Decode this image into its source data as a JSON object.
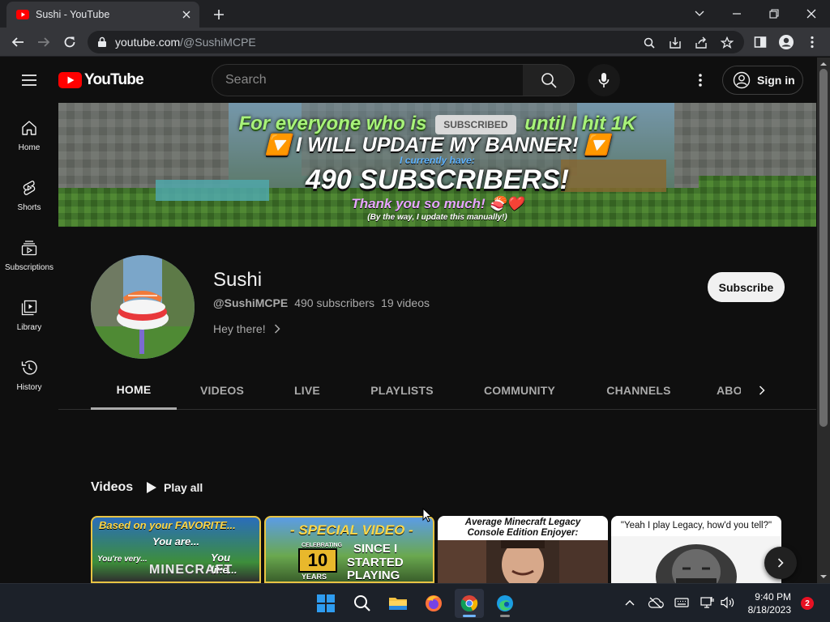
{
  "browser": {
    "tab_title": "Sushi - YouTube",
    "url_host": "youtube.com",
    "url_path": "/@SushiMCPE"
  },
  "masthead": {
    "logo_text": "YouTube",
    "search_placeholder": "Search",
    "sign_in_label": "Sign in"
  },
  "guide": {
    "items": [
      {
        "label": "Home",
        "icon": "home-icon"
      },
      {
        "label": "Shorts",
        "icon": "shorts-icon"
      },
      {
        "label": "Subscriptions",
        "icon": "subscriptions-icon"
      },
      {
        "label": "Library",
        "icon": "library-icon"
      },
      {
        "label": "History",
        "icon": "history-icon"
      }
    ]
  },
  "banner": {
    "line1_a": "For everyone who is",
    "line1_pill": "SUBSCRIBED",
    "line1_b": "until I hit 1K",
    "line2": "🔽 I WILL UPDATE MY BANNER! 🔽",
    "line3": "I currently have:",
    "line4": "490 SUBSCRIBERS!",
    "line5": "Thank you so much! 🍣❤️",
    "line6": "(By the way, I update this manually!)"
  },
  "channel": {
    "name": "Sushi",
    "handle": "@SushiMCPE",
    "subscribers": "490 subscribers",
    "videos": "19 videos",
    "about": "Hey there!",
    "subscribe_label": "Subscribe"
  },
  "tabs": [
    {
      "label": "HOME",
      "active": true
    },
    {
      "label": "VIDEOS",
      "active": false
    },
    {
      "label": "LIVE",
      "active": false
    },
    {
      "label": "PLAYLISTS",
      "active": false
    },
    {
      "label": "COMMUNITY",
      "active": false
    },
    {
      "label": "CHANNELS",
      "active": false
    },
    {
      "label": "ABO",
      "active": false
    }
  ],
  "shelf": {
    "title": "Videos",
    "play_all_label": "Play all",
    "thumbnails": [
      {
        "top_text": "Based on your FAVORITE...",
        "line2": "You are...",
        "line3": "You like...",
        "sub": "You're very...",
        "badge": "MINECRAFT"
      },
      {
        "top_text": "- SPECIAL VIDEO -",
        "line2": "SINCE I",
        "line3": "STARTED",
        "line4": "PLAYING",
        "badge": "10",
        "badge_sub": "YEARS",
        "celebrating": "CELEBRATING"
      },
      {
        "top_text": "Average Minecraft Legacy",
        "line2": "Console Edition Enjoyer:"
      },
      {
        "top_text": "\"Yeah I play Legacy, how'd you tell?\""
      }
    ]
  },
  "taskbar": {
    "time": "9:40 PM",
    "date": "8/18/2023",
    "notification_count": "2"
  },
  "colors": {
    "yt_red": "#ff0000",
    "page_bg": "#0f0f0f",
    "chrome_frame": "#202124",
    "chrome_toolbar": "#35363a"
  }
}
